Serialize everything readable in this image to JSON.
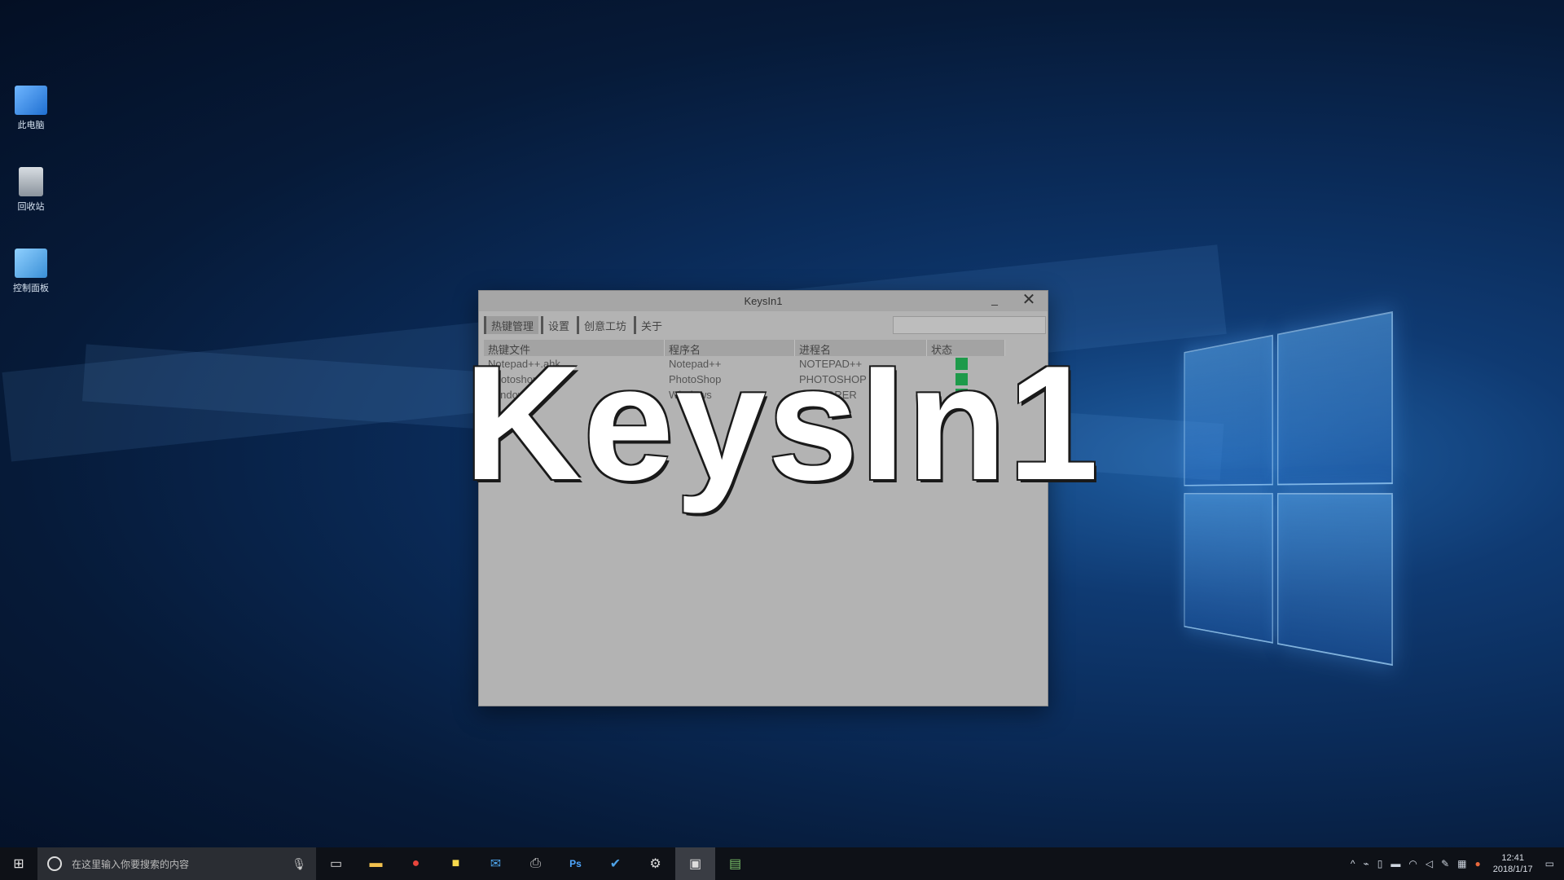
{
  "desktop_icons": [
    {
      "name": "此电脑",
      "icon": "computer-icon"
    },
    {
      "name": "回收站",
      "icon": "recycle-bin-icon"
    },
    {
      "name": "控制面板",
      "icon": "control-panel-icon"
    }
  ],
  "window": {
    "title": "KeysIn1",
    "minimize_glyph": "_",
    "close_glyph": "✕",
    "tabs": [
      "热键管理",
      "设置",
      "创意工坊",
      "关于"
    ],
    "search_value": "",
    "columns": [
      "热键文件",
      "程序名",
      "进程名",
      "状态"
    ],
    "rows": [
      {
        "file": "Notepad++.ahk",
        "program": "Notepad++",
        "process": "NOTEPAD++",
        "status": "on"
      },
      {
        "file": "Photoshop.ahk",
        "program": "PhotoShop",
        "process": "PHOTOSHOP",
        "status": "on"
      },
      {
        "file": "Windows.ahk",
        "program": "Windows",
        "process": "EXPLORER",
        "status": "on"
      },
      {
        "file": "",
        "program": "",
        "process": "",
        "status": ""
      }
    ]
  },
  "headline": "KeysIn1",
  "taskbar": {
    "search_placeholder": "在这里输入你要搜索的内容",
    "apps": [
      "task-view-icon",
      "file-explorer-icon",
      "chrome-icon",
      "sticky-notes-icon",
      "mail-icon",
      "printer-icon",
      "photoshop-icon",
      "check-icon",
      "settings-icon",
      "keysin1-icon",
      "notepad-icon"
    ],
    "clock_time": "12:41",
    "clock_date": "2018/1/17"
  },
  "colors": {
    "status_on": "#1d9a4a",
    "window_bg": "#b3b3b3",
    "taskbar_bg": "#0e1117"
  }
}
